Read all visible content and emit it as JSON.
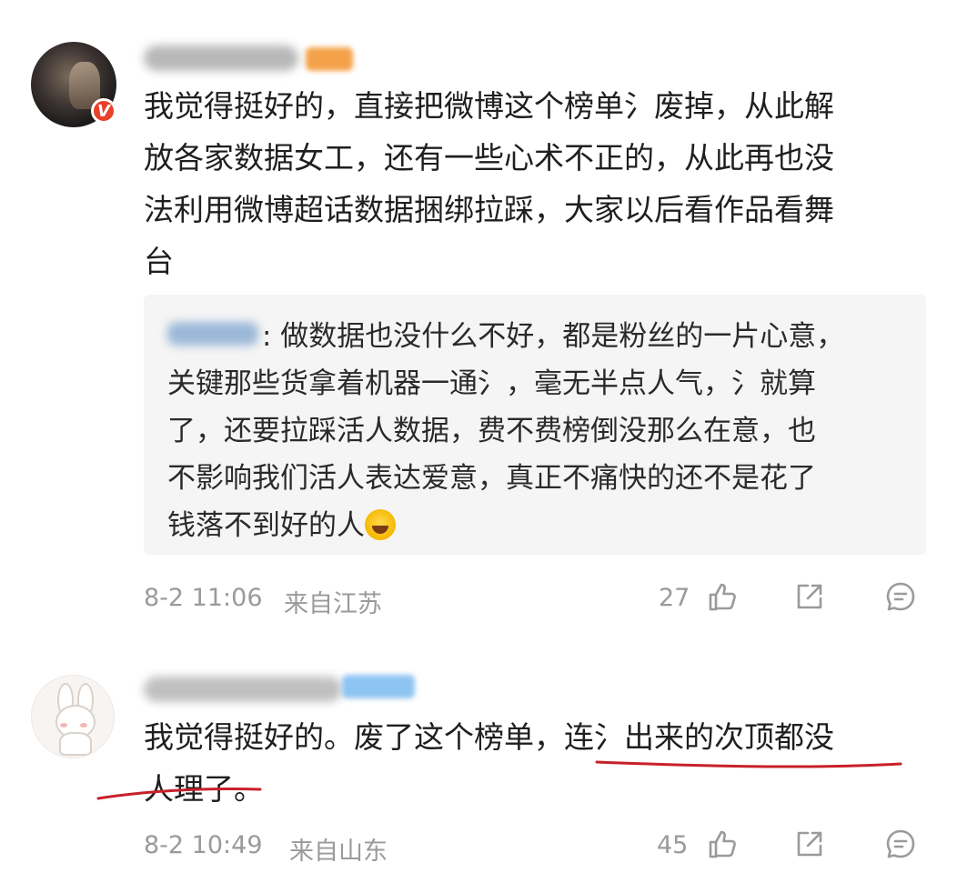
{
  "comments": [
    {
      "text": "我觉得挺好的，直接把微博这个榜单氵废掉，从此解\n放各家数据女工，还有一些心术不正的，从此再也没\n法利用微博超话数据捆绑拉踩，大家以后看作品看舞\n台",
      "reply": {
        "name_suffix": "",
        "text_line1": ": 做数据也没什么不好，都是粉丝的一片心意，",
        "text_rest": "关键那些货拿着机器一通氵，毫无半点人气，氵就算\n了，还要拉踩活人数据，费不费榜倒没那么在意，也\n不影响我们活人表达爱意，真正不痛快的还不是花了\n钱落不到好的人"
      },
      "time": "8-2 11:06",
      "location": "来自江苏",
      "likes": "27"
    },
    {
      "text": "我觉得挺好的。废了这个榜单，连氵出来的次顶都没\n人理了。",
      "time": "8-2 10:49",
      "location": "来自山东",
      "likes": "45"
    }
  ],
  "icons": {
    "like": "thumbs-up-icon",
    "share": "share-icon",
    "comment": "comment-icon",
    "verified": "verified-v-badge",
    "emoji": "laughing-tears-emoji"
  },
  "colors": {
    "verified_badge": "#e8402a",
    "underline": "#c8202a",
    "meta_text": "#9a9a9a",
    "reply_bg": "#f5f5f5"
  },
  "badge_text": "V"
}
